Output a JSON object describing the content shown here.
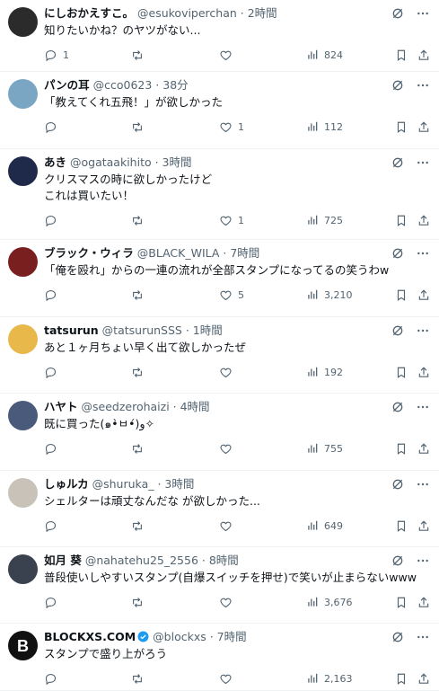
{
  "tweets": [
    {
      "name": "にしおかえすこ。",
      "handle": "@esukoviperchan",
      "time": "2時間",
      "text": "知りたいかね？のヤツがない...",
      "replies": "1",
      "retweets": "",
      "likes": "",
      "views": "824",
      "avatar_color": "#2b2b2b",
      "verified": false,
      "height": 80
    },
    {
      "name": "パンの耳",
      "handle": "@cco0623",
      "time": "38分",
      "text": "「教えてくれ五飛！」が欲しかった",
      "replies": "",
      "retweets": "",
      "likes": "1",
      "views": "112",
      "avatar_color": "#7aa6c4",
      "verified": false,
      "height": 86
    },
    {
      "name": "あき",
      "handle": "@ogataakihito",
      "time": "3時間",
      "text": "クリスマスの時に欲しかったけど\nこれは買いたい！",
      "replies": "",
      "retweets": "",
      "likes": "1",
      "views": "725",
      "avatar_color": "#1f2a4a",
      "verified": false,
      "height": 101
    },
    {
      "name": "ブラック・ウィラ",
      "handle": "@BLACK_WILA",
      "time": "7時間",
      "text": "「俺を殴れ」からの一連の流れが全部スタンプになってるの笑うわw",
      "replies": "",
      "retweets": "",
      "likes": "5",
      "views": "3,210",
      "avatar_color": "#7a1f1f",
      "verified": false,
      "height": 86
    },
    {
      "name": "tatsurun",
      "handle": "@tatsurunSSS",
      "time": "1時間",
      "text": "あと１ヶ月ちょい早く出て欲しかったぜ",
      "replies": "",
      "retweets": "",
      "likes": "",
      "views": "192",
      "avatar_color": "#e8b84a",
      "verified": false,
      "height": 85
    },
    {
      "name": "ハヤト",
      "handle": "@seedzerohaizi",
      "time": "4時間",
      "text": "既に買った(๑•̀ㅂ•́)و✧",
      "replies": "",
      "retweets": "",
      "likes": "",
      "views": "755",
      "avatar_color": "#4a5a7a",
      "verified": false,
      "height": 86
    },
    {
      "name": "しゅルカ",
      "handle": "@shuruka_",
      "time": "3時間",
      "text": "シェルターは頑丈なんだな が欲しかった...",
      "replies": "",
      "retweets": "",
      "likes": "",
      "views": "649",
      "avatar_color": "#c9c2b8",
      "verified": false,
      "height": 85
    },
    {
      "name": "如月 葵",
      "handle": "@nahatehu25_2556",
      "time": "8時間",
      "text": "普段使いしやすいスタンプ(自爆スイッチを押せ)で笑いが止まらないwww",
      "replies": "",
      "retweets": "",
      "likes": "",
      "views": "3,676",
      "avatar_color": "#3a4250",
      "verified": false,
      "height": 85
    },
    {
      "name": "BLOCKXS.COM",
      "handle": "@blockxs",
      "time": "7時間",
      "text": "スタンプで盛り上がろう",
      "replies": "",
      "retweets": "",
      "likes": "",
      "views": "2,163",
      "avatar_color": "#111111",
      "verified": true,
      "height": 75
    }
  ]
}
